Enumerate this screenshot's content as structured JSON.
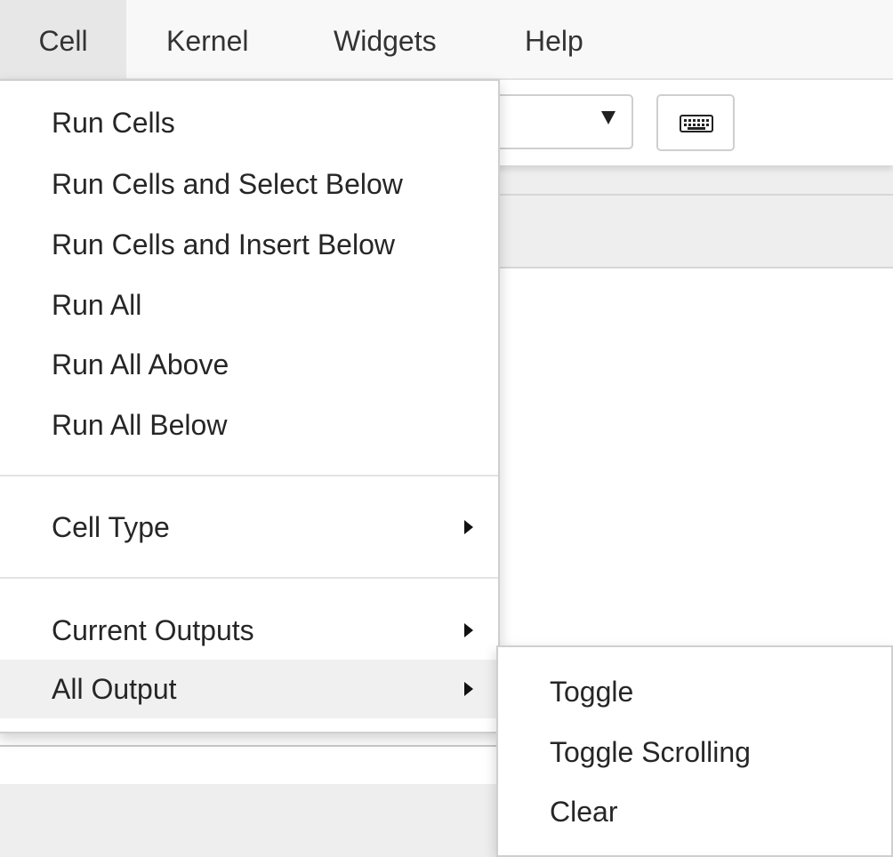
{
  "menubar": {
    "items": [
      {
        "label": "Cell"
      },
      {
        "label": "Kernel"
      },
      {
        "label": "Widgets"
      },
      {
        "label": "Help"
      }
    ]
  },
  "cell_menu": {
    "run_group": [
      {
        "label": "Run Cells"
      },
      {
        "label": "Run Cells and Select Below"
      },
      {
        "label": "Run Cells and Insert Below"
      },
      {
        "label": "Run All"
      },
      {
        "label": "Run All Above"
      },
      {
        "label": "Run All Below"
      }
    ],
    "cell_type": {
      "label": "Cell Type",
      "has_submenu": true
    },
    "current_outputs": {
      "label": "Current Outputs",
      "has_submenu": true
    },
    "all_output": {
      "label": "All Output",
      "has_submenu": true,
      "highlighted": true
    }
  },
  "all_output_submenu": {
    "items": [
      {
        "label": "Toggle"
      },
      {
        "label": "Toggle Scrolling"
      },
      {
        "label": "Clear"
      }
    ]
  },
  "toolbar": {
    "keyboard_icon": "keyboard-icon",
    "select_arrow_icon": "triangle-down-icon"
  },
  "colors": {
    "menubar_bg": "#f8f8f8",
    "open_menu_bg": "#e7e7e7",
    "highlight_bg": "#f0f0f0",
    "border": "#cfcfcf"
  }
}
